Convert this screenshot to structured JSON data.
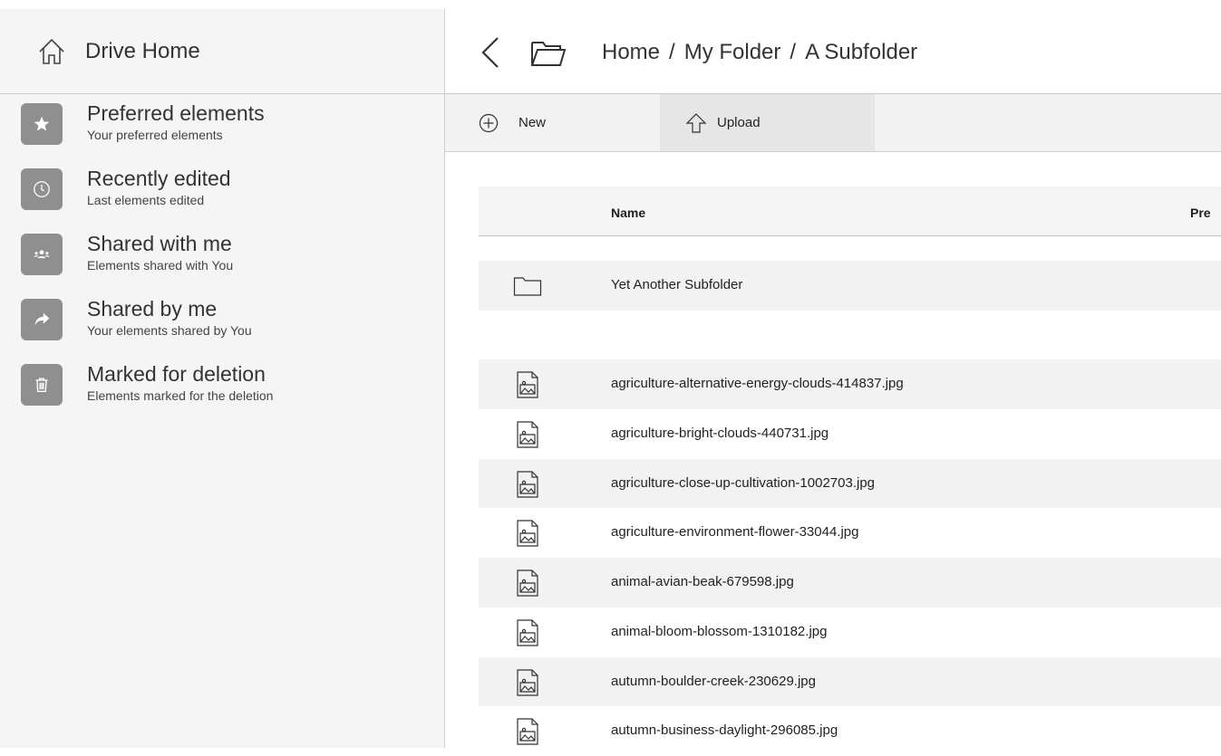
{
  "sidebar": {
    "home_label": "Drive Home",
    "items": [
      {
        "icon": "star-icon",
        "title": "Preferred elements",
        "subtitle": "Your preferred elements"
      },
      {
        "icon": "clock-icon",
        "title": "Recently edited",
        "subtitle": "Last elements edited"
      },
      {
        "icon": "users-icon",
        "title": "Shared with me",
        "subtitle": "Elements shared with You"
      },
      {
        "icon": "share-icon",
        "title": "Shared by me",
        "subtitle": "Your elements shared by You"
      },
      {
        "icon": "trash-icon",
        "title": "Marked for deletion",
        "subtitle": "Elements marked for the deletion"
      }
    ]
  },
  "header": {
    "breadcrumb": [
      "Home",
      "My Folder",
      "A Subfolder"
    ],
    "separator": "/"
  },
  "toolbar": {
    "new_label": "New",
    "upload_label": "Upload"
  },
  "table": {
    "columns": {
      "name": "Name",
      "preferred": "Pre"
    },
    "rows": [
      {
        "type": "folder",
        "name": "Yet Another Subfolder"
      },
      {
        "type": "empty",
        "name": ""
      },
      {
        "type": "image",
        "name": "agriculture-alternative-energy-clouds-414837.jpg"
      },
      {
        "type": "image",
        "name": "agriculture-bright-clouds-440731.jpg"
      },
      {
        "type": "image",
        "name": "agriculture-close-up-cultivation-1002703.jpg"
      },
      {
        "type": "image",
        "name": "agriculture-environment-flower-33044.jpg"
      },
      {
        "type": "image",
        "name": "animal-avian-beak-679598.jpg"
      },
      {
        "type": "image",
        "name": "animal-bloom-blossom-1310182.jpg"
      },
      {
        "type": "image",
        "name": "autumn-boulder-creek-230629.jpg"
      },
      {
        "type": "image",
        "name": "autumn-business-daylight-296085.jpg"
      }
    ]
  },
  "colors": {
    "sidebar_bg": "#f5f5f5",
    "tile_bg": "#8f8f8f",
    "row_alt": "#f2f2f2",
    "divider": "#c8c8c8"
  }
}
